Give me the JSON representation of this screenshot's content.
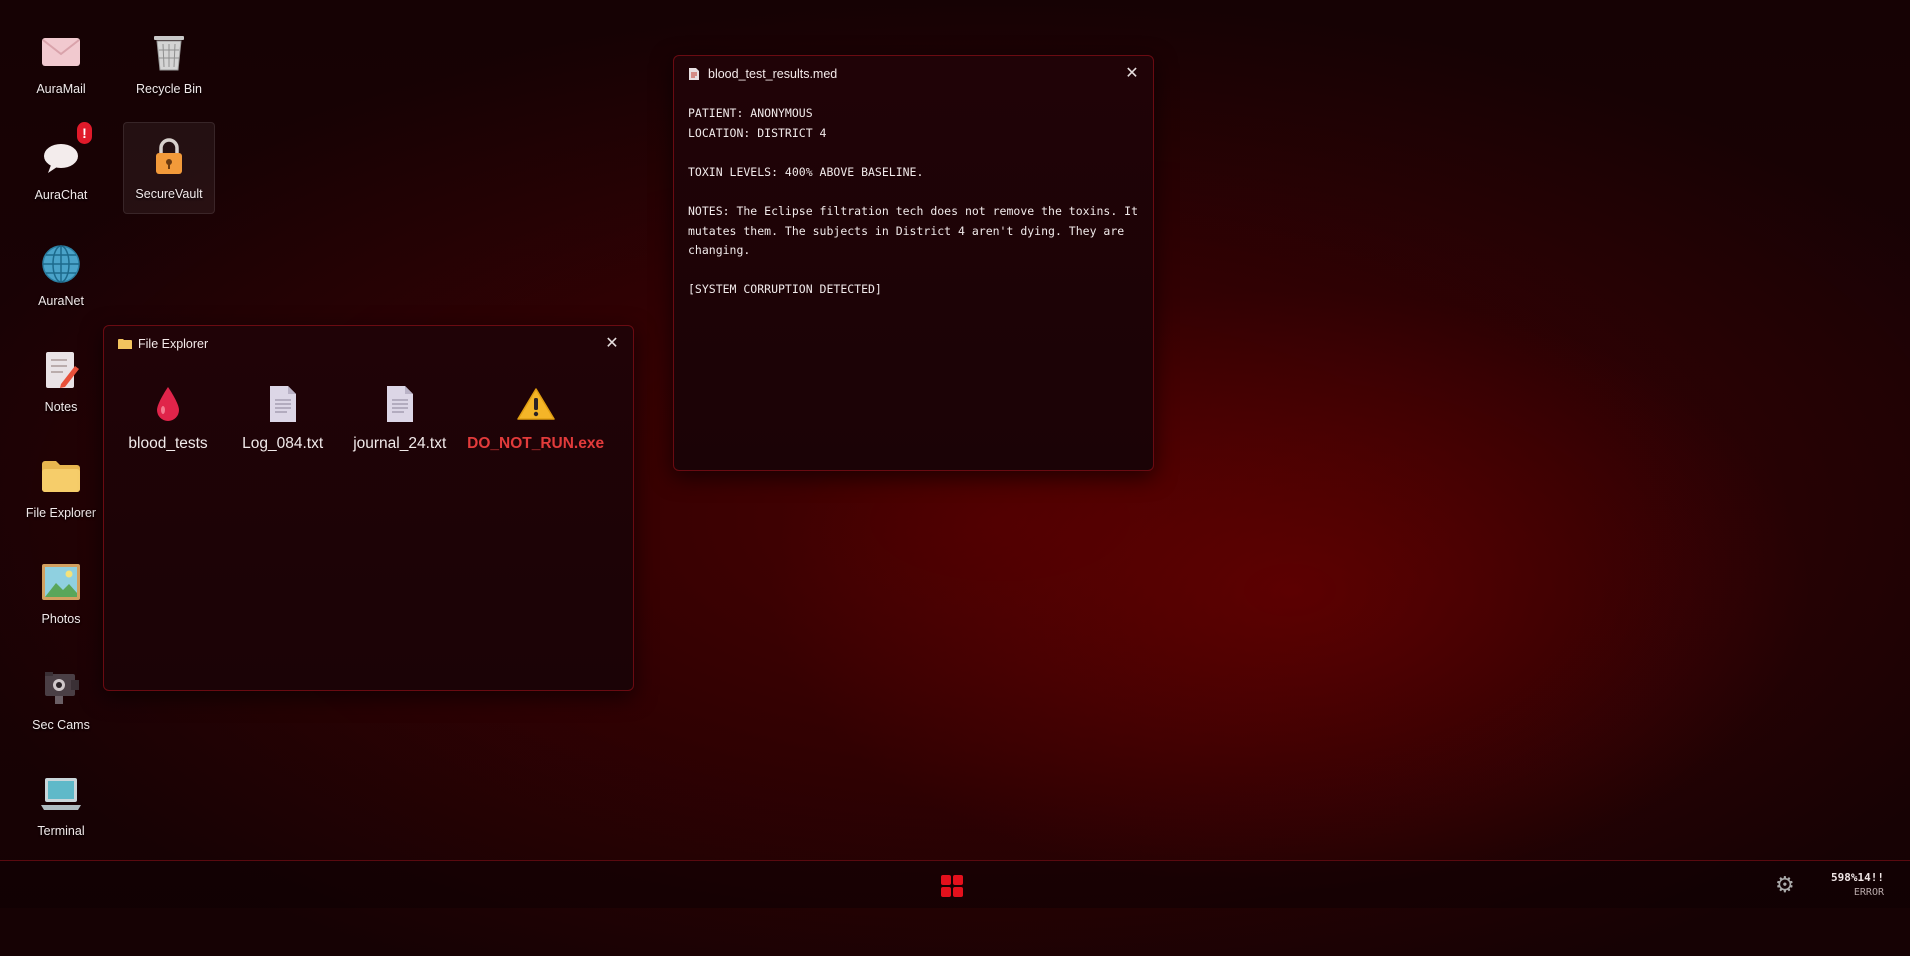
{
  "desktop": {
    "icons": [
      {
        "label": "AuraMail",
        "icon": "mail-icon"
      },
      {
        "label": "Recycle Bin",
        "icon": "recycle-bin-icon"
      },
      {
        "label": "AuraChat",
        "icon": "chat-bubble-icon",
        "badge": "!"
      },
      {
        "label": "SecureVault",
        "icon": "lock-icon"
      },
      {
        "label": "AuraNet",
        "icon": "globe-icon"
      },
      {
        "label": "Notes",
        "icon": "notes-icon"
      },
      {
        "label": "File Explorer",
        "icon": "folder-icon"
      },
      {
        "label": "Photos",
        "icon": "photo-icon"
      },
      {
        "label": "Sec Cams",
        "icon": "camera-icon"
      },
      {
        "label": "Terminal",
        "icon": "laptop-icon"
      }
    ]
  },
  "doc_window": {
    "title": "blood_test_results.med",
    "lines": [
      "PATIENT: ANONYMOUS",
      "LOCATION: DISTRICT 4",
      "TOXIN LEVELS: 400% ABOVE BASELINE.",
      "NOTES: The Eclipse filtration tech does not remove the toxins. It mutates them. The subjects in District 4 aren't dying. They are changing.",
      "[SYSTEM CORRUPTION DETECTED]"
    ]
  },
  "file_explorer": {
    "title": "File Explorer",
    "items": [
      {
        "name": "blood_tests",
        "icon": "blood-drop-icon"
      },
      {
        "name": "Log_084.txt",
        "icon": "text-file-icon"
      },
      {
        "name": "journal_24.txt",
        "icon": "text-file-icon"
      },
      {
        "name": "DO_NOT_RUN.exe",
        "icon": "warning-icon",
        "danger": true
      }
    ]
  },
  "taskbar": {
    "clock_time": "598%14!!",
    "clock_date": "ERROR"
  },
  "colors": {
    "accent": "#e4101c",
    "danger_text": "#e23b3b",
    "window_border": "#6a0b12"
  }
}
